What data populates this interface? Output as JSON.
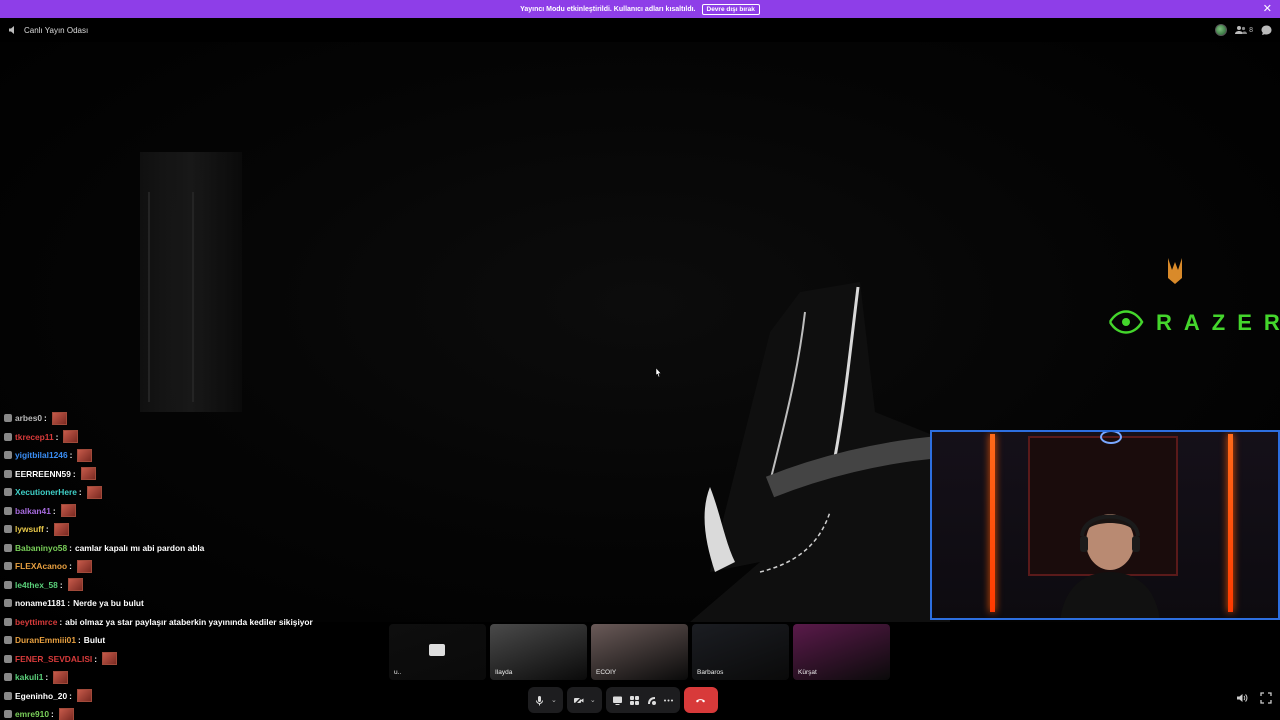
{
  "banner": {
    "text": "Yayıncı Modu etkinleştirildi. Kullanıcı adları kısaltıldı.",
    "button": "Devre dışı bırak",
    "close": "✕",
    "bg_color": "#8e3ee8"
  },
  "topbar": {
    "channel_title": "Canlı Yayın Odası",
    "participant_count": "8"
  },
  "stream": {
    "brand_text": "RAZER",
    "brand_color": "#44d62c"
  },
  "chat": [
    {
      "user": "arbes0",
      "color": "#bbbbbb",
      "msg": "",
      "emote": true
    },
    {
      "user": "tkrecep11",
      "color": "#d93b3b",
      "msg": "",
      "emote": true
    },
    {
      "user": "yigitbilal1246",
      "color": "#3a8ef5",
      "msg": "",
      "emote": true
    },
    {
      "user": "EERREENN59",
      "color": "#ffffff",
      "msg": "",
      "emote": true
    },
    {
      "user": "XecutionerHere",
      "color": "#3fd0c8",
      "msg": "",
      "emote": true
    },
    {
      "user": "balkan41",
      "color": "#a86ce0",
      "msg": "",
      "emote": true
    },
    {
      "user": "lywsuff",
      "color": "#e8c84a",
      "msg": "",
      "emote": true
    },
    {
      "user": "Babaninyo58",
      "color": "#7ad05a",
      "msg": "camlar kapalı mı abi pardon abla",
      "emote": false
    },
    {
      "user": "FLEXAcanoo",
      "color": "#e8a040",
      "msg": "",
      "emote": true
    },
    {
      "user": "le4thex_58",
      "color": "#5ad07a",
      "msg": "",
      "emote": true
    },
    {
      "user": "noname1181",
      "color": "#ffffff",
      "msg": "Nerde ya bu bulut",
      "emote": false
    },
    {
      "user": "beyttimrce",
      "color": "#d93b3b",
      "msg": "abi olmaz ya star paylaşır ataberkin yayınında kediler sikişiyor",
      "emote": false
    },
    {
      "user": "DuranEmmiii01",
      "color": "#e8a040",
      "msg": "Bulut",
      "emote": false
    },
    {
      "user": "FENER_SEVDALISI",
      "color": "#d93b3b",
      "msg": "",
      "emote": true
    },
    {
      "user": "kakuli1",
      "color": "#5ad07a",
      "msg": "",
      "emote": true
    },
    {
      "user": "Egeninho_20",
      "color": "#ffffff",
      "msg": "",
      "emote": true
    },
    {
      "user": "emre910",
      "color": "#7ad05a",
      "msg": "",
      "emote": true
    }
  ],
  "participants": [
    {
      "name": "u..",
      "bg": "#0e0e0e"
    },
    {
      "name": "Ilayda",
      "bg": "#4a4a4a"
    },
    {
      "name": "ECOIY",
      "bg": "#6a5a58"
    },
    {
      "name": "Barbaros",
      "bg": "#1b1d22"
    },
    {
      "name": "Kürşat",
      "bg": "#5a1a4a"
    }
  ],
  "icons": [
    "speaker-icon",
    "mic-icon",
    "camera-off-icon",
    "screenshare-icon",
    "activities-icon",
    "soundboard-icon",
    "more-icon",
    "hangup-icon",
    "volume-icon",
    "fullscreen-icon"
  ]
}
